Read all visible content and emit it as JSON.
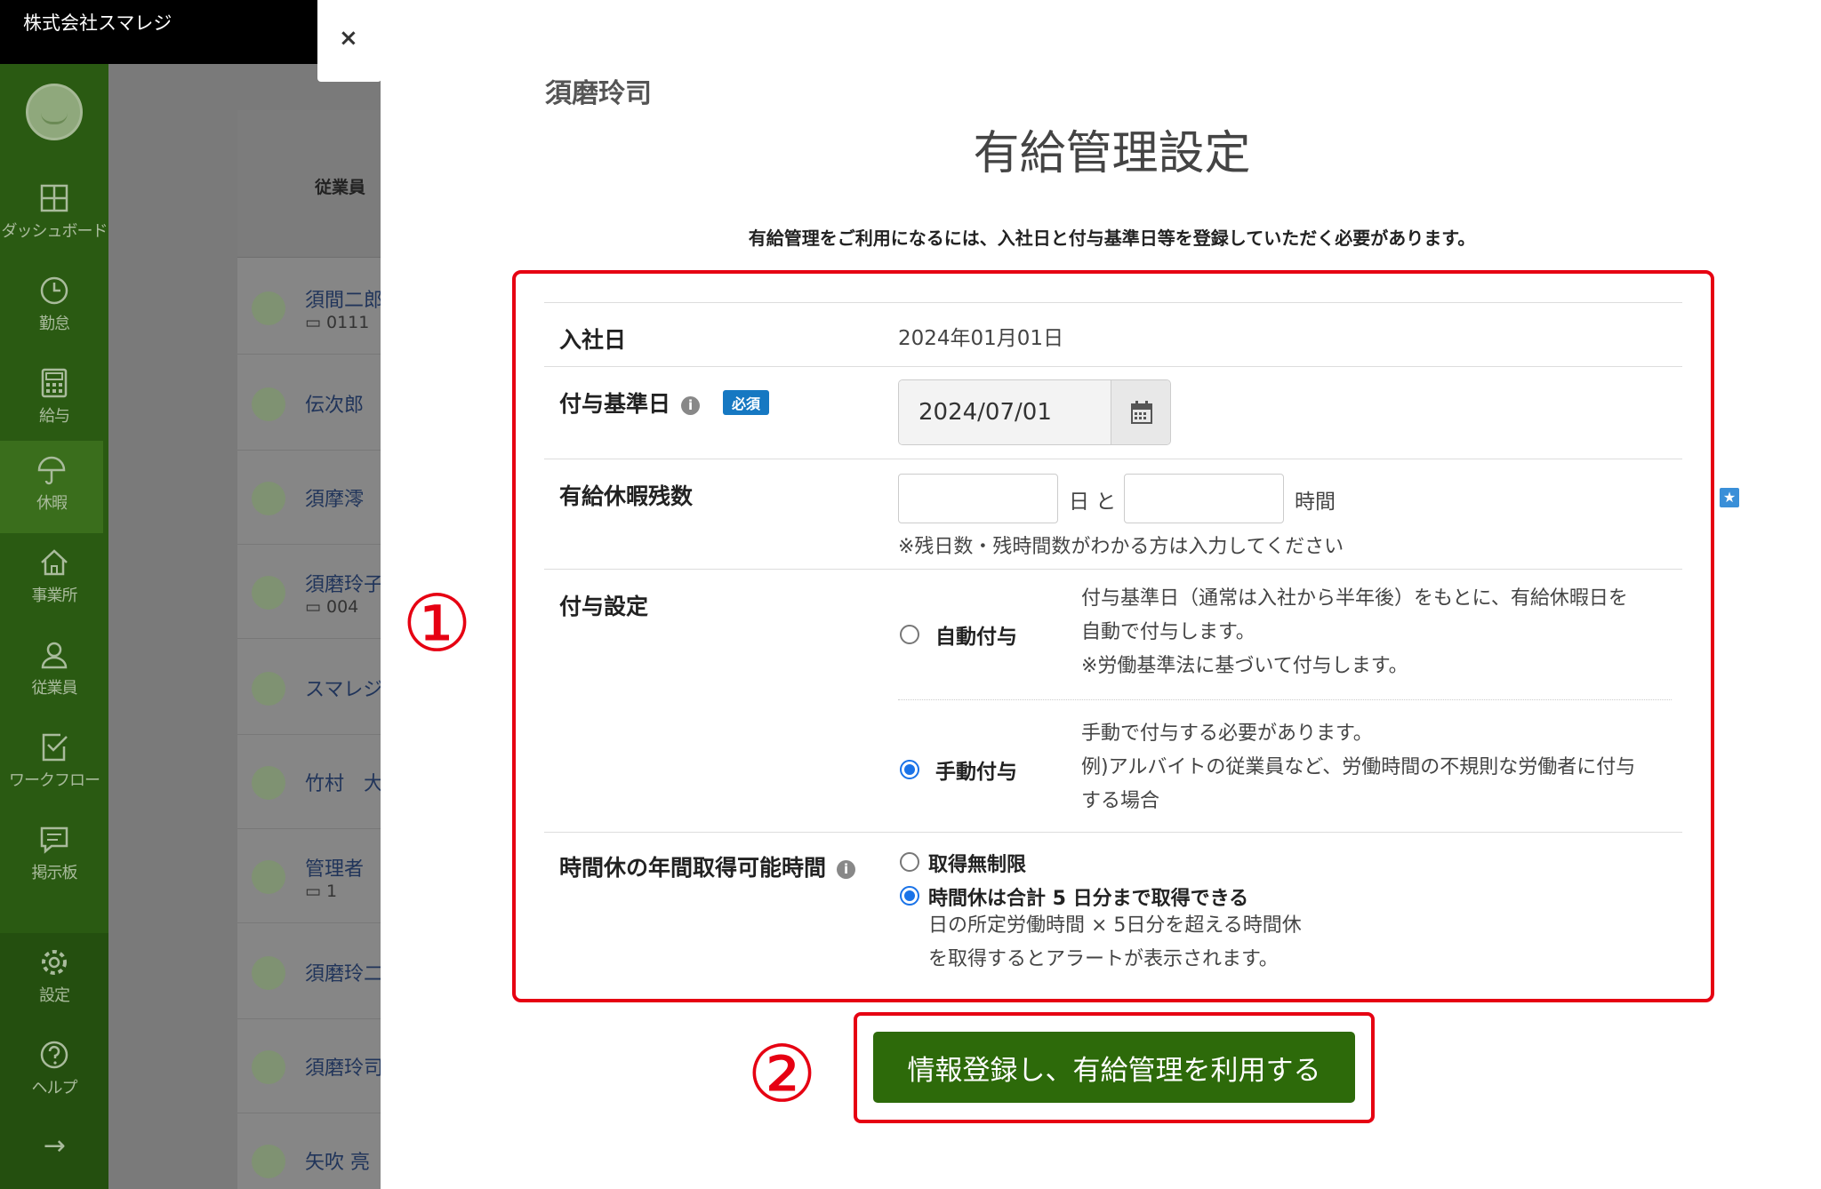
{
  "header": {
    "company": "株式会社スマレジ"
  },
  "sidebar": {
    "items": [
      {
        "label": "ダッシュボード",
        "icon": "dashboard-icon"
      },
      {
        "label": "勤怠",
        "icon": "clock-icon"
      },
      {
        "label": "給与",
        "icon": "calculator-icon"
      },
      {
        "label": "休暇",
        "icon": "umbrella-icon"
      },
      {
        "label": "事業所",
        "icon": "home-icon"
      },
      {
        "label": "従業員",
        "icon": "person-icon"
      },
      {
        "label": "ワークフロー",
        "icon": "checklist-icon"
      },
      {
        "label": "掲示板",
        "icon": "message-icon"
      },
      {
        "label": "設定",
        "icon": "gear-icon"
      },
      {
        "label": "ヘルプ",
        "icon": "help-icon"
      }
    ],
    "expand_icon": "→",
    "active_color": "#3a6e1c"
  },
  "employee_list": {
    "header": "従業員",
    "rows": [
      {
        "name": "須間二郎",
        "code": "0111"
      },
      {
        "name": "伝次郎",
        "code": ""
      },
      {
        "name": "須摩澪",
        "code": ""
      },
      {
        "name": "須磨玲子",
        "code": "004"
      },
      {
        "name": "スマレジ",
        "code": ""
      },
      {
        "name": "竹村　大",
        "code": ""
      },
      {
        "name": "管理者",
        "code": "1"
      },
      {
        "name": "須磨玲二",
        "code": ""
      },
      {
        "name": "須磨玲司",
        "code": ""
      },
      {
        "name": "矢吹 亮",
        "code": ""
      }
    ]
  },
  "modal": {
    "close": "×",
    "employee_name": "須磨玲司",
    "title": "有給管理設定",
    "lead": "有給管理をご利用になるには、入社日と付与基準日等を登録していただく必要があります。",
    "join_date": {
      "label": "入社日",
      "value": "2024年01月01日"
    },
    "grant_date": {
      "label": "付与基準日",
      "required": "必須",
      "value": "2024/07/01"
    },
    "remaining": {
      "label": "有給休暇残数",
      "days_value": "",
      "days_unit": "日 と",
      "hours_value": "",
      "hours_unit": "時間",
      "note": "※残日数・残時間数がわかる方は入力してください"
    },
    "grant_setting": {
      "label": "付与設定",
      "auto": {
        "label": "自動付与",
        "desc1": "付与基準日（通常は入社から半年後）をもとに、有給休暇日を",
        "desc2": "自動で付与します。",
        "desc3": "※労働基準法に基づいて付与します。"
      },
      "manual": {
        "label": "手動付与",
        "desc1": "手動で付与する必要があります。",
        "desc2": "例)アルバイトの従業員など、労働時間の不規則な労働者に付与",
        "desc3": "する場合"
      },
      "selected": "manual"
    },
    "hourly_leave": {
      "label": "時間休の年間取得可能時間",
      "opt_unlimited": "取得無制限",
      "opt_limited": "時間休は合計 5 日分まで取得できる",
      "note1": "日の所定労働時間 × 5日分を超える時間休",
      "note2": "を取得するとアラートが表示されます。",
      "selected": "limited"
    },
    "submit": "情報登録し、有給管理を利用する",
    "annotation1": "①",
    "annotation2": "②"
  },
  "colors": {
    "accent_green": "#2d6a0a",
    "annotation_red": "#e60012",
    "radio_blue": "#1a73e8",
    "badge_blue": "#1678c2"
  }
}
